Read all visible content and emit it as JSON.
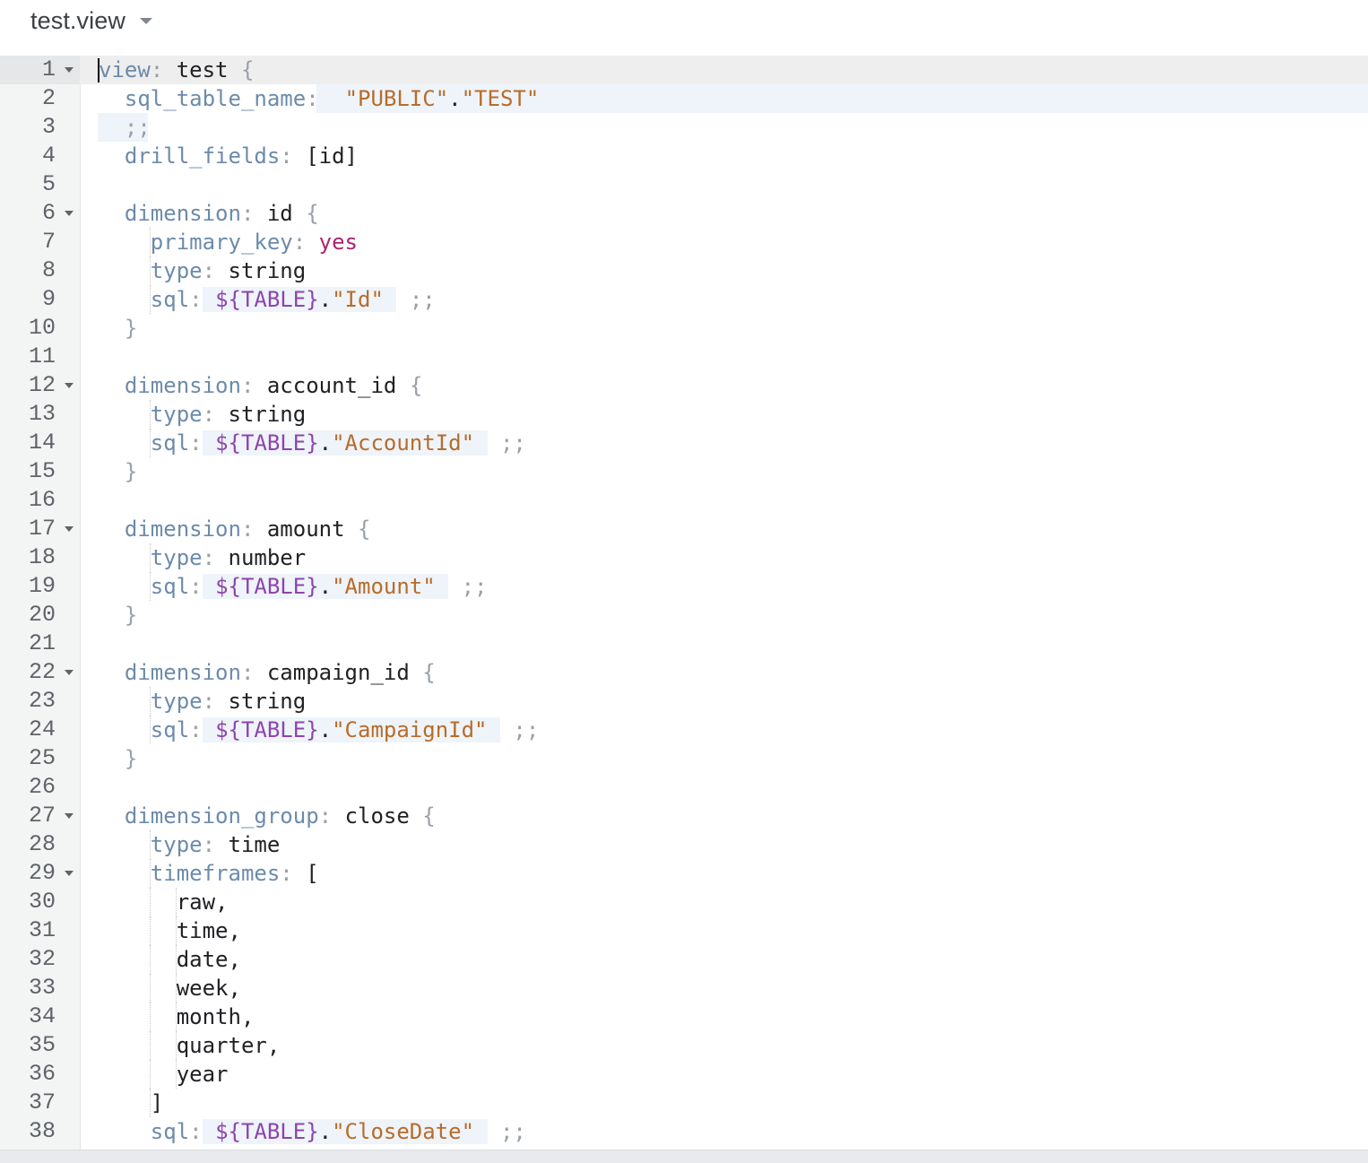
{
  "file": {
    "name": "test.view",
    "dropdown_icon": "caret-down-icon"
  },
  "colors": {
    "keyword": "#6c8bab",
    "punctuation": "#9aa0a6",
    "string": "#b86c2a",
    "variable": "#8e44ad",
    "yesno": "#b0226f",
    "gutter_bg": "#f3f4f4",
    "active_line_bg": "#eeeeee"
  },
  "lines": [
    {
      "n": "1",
      "fold": true,
      "tokens": [
        [
          "k",
          "view"
        ],
        [
          "p",
          ": "
        ],
        [
          "t",
          "test "
        ],
        [
          "p",
          "{"
        ]
      ]
    },
    {
      "n": "2",
      "tokens": [
        [
          "t",
          "  "
        ],
        [
          "k",
          "sql_table_name"
        ],
        [
          "p",
          ": "
        ],
        [
          "t",
          " "
        ],
        [
          "s",
          "\"PUBLIC\""
        ],
        [
          "t",
          "."
        ],
        [
          "s",
          "\"TEST\""
        ]
      ]
    },
    {
      "n": "3",
      "tokens": [
        [
          "t",
          "  "
        ],
        [
          "p",
          ";;"
        ]
      ]
    },
    {
      "n": "4",
      "tokens": [
        [
          "t",
          "  "
        ],
        [
          "k",
          "drill_fields"
        ],
        [
          "p",
          ": "
        ],
        [
          "t",
          "[id]"
        ]
      ]
    },
    {
      "n": "5",
      "tokens": []
    },
    {
      "n": "6",
      "fold": true,
      "tokens": [
        [
          "t",
          "  "
        ],
        [
          "k",
          "dimension"
        ],
        [
          "p",
          ": "
        ],
        [
          "t",
          "id "
        ],
        [
          "p",
          "{"
        ]
      ]
    },
    {
      "n": "7",
      "tokens": [
        [
          "t",
          "    "
        ],
        [
          "k",
          "primary_key"
        ],
        [
          "p",
          ": "
        ],
        [
          "y",
          "yes"
        ]
      ]
    },
    {
      "n": "8",
      "tokens": [
        [
          "t",
          "    "
        ],
        [
          "k",
          "type"
        ],
        [
          "p",
          ": "
        ],
        [
          "t",
          "string"
        ]
      ]
    },
    {
      "n": "9",
      "tokens": [
        [
          "t",
          "    "
        ],
        [
          "k",
          "sql"
        ],
        [
          "p",
          ":"
        ],
        [
          "h",
          " "
        ],
        [
          "hv",
          "${TABLE}"
        ],
        [
          "h",
          "."
        ],
        [
          "hs",
          "\"Id\""
        ],
        [
          "h",
          " "
        ],
        [
          "t",
          " "
        ],
        [
          "p",
          ";;"
        ]
      ]
    },
    {
      "n": "10",
      "tokens": [
        [
          "t",
          "  "
        ],
        [
          "p",
          "}"
        ]
      ]
    },
    {
      "n": "11",
      "tokens": []
    },
    {
      "n": "12",
      "fold": true,
      "tokens": [
        [
          "t",
          "  "
        ],
        [
          "k",
          "dimension"
        ],
        [
          "p",
          ": "
        ],
        [
          "t",
          "account_id "
        ],
        [
          "p",
          "{"
        ]
      ]
    },
    {
      "n": "13",
      "tokens": [
        [
          "t",
          "    "
        ],
        [
          "k",
          "type"
        ],
        [
          "p",
          ": "
        ],
        [
          "t",
          "string"
        ]
      ]
    },
    {
      "n": "14",
      "tokens": [
        [
          "t",
          "    "
        ],
        [
          "k",
          "sql"
        ],
        [
          "p",
          ":"
        ],
        [
          "h",
          " "
        ],
        [
          "hv",
          "${TABLE}"
        ],
        [
          "h",
          "."
        ],
        [
          "hs",
          "\"AccountId\""
        ],
        [
          "h",
          " "
        ],
        [
          "t",
          " "
        ],
        [
          "p",
          ";;"
        ]
      ]
    },
    {
      "n": "15",
      "tokens": [
        [
          "t",
          "  "
        ],
        [
          "p",
          "}"
        ]
      ]
    },
    {
      "n": "16",
      "tokens": []
    },
    {
      "n": "17",
      "fold": true,
      "tokens": [
        [
          "t",
          "  "
        ],
        [
          "k",
          "dimension"
        ],
        [
          "p",
          ": "
        ],
        [
          "t",
          "amount "
        ],
        [
          "p",
          "{"
        ]
      ]
    },
    {
      "n": "18",
      "tokens": [
        [
          "t",
          "    "
        ],
        [
          "k",
          "type"
        ],
        [
          "p",
          ": "
        ],
        [
          "t",
          "number"
        ]
      ]
    },
    {
      "n": "19",
      "tokens": [
        [
          "t",
          "    "
        ],
        [
          "k",
          "sql"
        ],
        [
          "p",
          ":"
        ],
        [
          "h",
          " "
        ],
        [
          "hv",
          "${TABLE}"
        ],
        [
          "h",
          "."
        ],
        [
          "hs",
          "\"Amount\""
        ],
        [
          "h",
          " "
        ],
        [
          "t",
          " "
        ],
        [
          "p",
          ";;"
        ]
      ]
    },
    {
      "n": "20",
      "tokens": [
        [
          "t",
          "  "
        ],
        [
          "p",
          "}"
        ]
      ]
    },
    {
      "n": "21",
      "tokens": []
    },
    {
      "n": "22",
      "fold": true,
      "tokens": [
        [
          "t",
          "  "
        ],
        [
          "k",
          "dimension"
        ],
        [
          "p",
          ": "
        ],
        [
          "t",
          "campaign_id "
        ],
        [
          "p",
          "{"
        ]
      ]
    },
    {
      "n": "23",
      "tokens": [
        [
          "t",
          "    "
        ],
        [
          "k",
          "type"
        ],
        [
          "p",
          ": "
        ],
        [
          "t",
          "string"
        ]
      ]
    },
    {
      "n": "24",
      "tokens": [
        [
          "t",
          "    "
        ],
        [
          "k",
          "sql"
        ],
        [
          "p",
          ":"
        ],
        [
          "h",
          " "
        ],
        [
          "hv",
          "${TABLE}"
        ],
        [
          "h",
          "."
        ],
        [
          "hs",
          "\"CampaignId\""
        ],
        [
          "h",
          " "
        ],
        [
          "t",
          " "
        ],
        [
          "p",
          ";;"
        ]
      ]
    },
    {
      "n": "25",
      "tokens": [
        [
          "t",
          "  "
        ],
        [
          "p",
          "}"
        ]
      ]
    },
    {
      "n": "26",
      "tokens": []
    },
    {
      "n": "27",
      "fold": true,
      "tokens": [
        [
          "t",
          "  "
        ],
        [
          "k",
          "dimension_group"
        ],
        [
          "p",
          ": "
        ],
        [
          "t",
          "close "
        ],
        [
          "p",
          "{"
        ]
      ]
    },
    {
      "n": "28",
      "tokens": [
        [
          "t",
          "    "
        ],
        [
          "k",
          "type"
        ],
        [
          "p",
          ": "
        ],
        [
          "t",
          "time"
        ]
      ]
    },
    {
      "n": "29",
      "fold": true,
      "tokens": [
        [
          "t",
          "    "
        ],
        [
          "k",
          "timeframes"
        ],
        [
          "p",
          ": "
        ],
        [
          "t",
          "["
        ]
      ]
    },
    {
      "n": "30",
      "tokens": [
        [
          "t",
          "      raw,"
        ]
      ]
    },
    {
      "n": "31",
      "tokens": [
        [
          "t",
          "      time,"
        ]
      ]
    },
    {
      "n": "32",
      "tokens": [
        [
          "t",
          "      date,"
        ]
      ]
    },
    {
      "n": "33",
      "tokens": [
        [
          "t",
          "      week,"
        ]
      ]
    },
    {
      "n": "34",
      "tokens": [
        [
          "t",
          "      month,"
        ]
      ]
    },
    {
      "n": "35",
      "tokens": [
        [
          "t",
          "      quarter,"
        ]
      ]
    },
    {
      "n": "36",
      "tokens": [
        [
          "t",
          "      year"
        ]
      ]
    },
    {
      "n": "37",
      "tokens": [
        [
          "t",
          "    ]"
        ]
      ]
    },
    {
      "n": "38",
      "tokens": [
        [
          "t",
          "    "
        ],
        [
          "k",
          "sql"
        ],
        [
          "p",
          ":"
        ],
        [
          "h",
          " "
        ],
        [
          "hv",
          "${TABLE}"
        ],
        [
          "h",
          "."
        ],
        [
          "hs",
          "\"CloseDate\""
        ],
        [
          "h",
          " "
        ],
        [
          "t",
          " "
        ],
        [
          "p",
          ";;"
        ]
      ]
    }
  ]
}
